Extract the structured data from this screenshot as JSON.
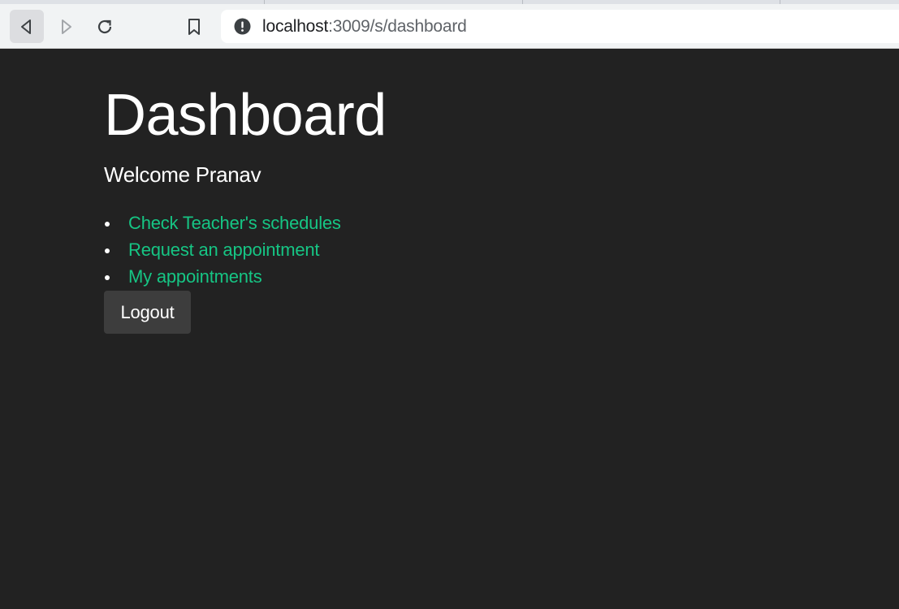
{
  "browser": {
    "url_host": "localhost",
    "url_rest": ":3009/s/dashboard",
    "icons": {
      "back": "back-arrow-icon",
      "forward": "forward-arrow-icon",
      "reload": "reload-icon",
      "bookmark": "bookmark-icon",
      "site_info": "info-icon"
    }
  },
  "page": {
    "title": "Dashboard",
    "welcome": "Welcome Pranav",
    "links": [
      {
        "label": "Check Teacher's schedules"
      },
      {
        "label": "Request an appointment"
      },
      {
        "label": "My appointments"
      }
    ],
    "logout_label": "Logout"
  },
  "colors": {
    "background": "#222222",
    "link": "#16c584",
    "button": "#3d3d3d"
  }
}
